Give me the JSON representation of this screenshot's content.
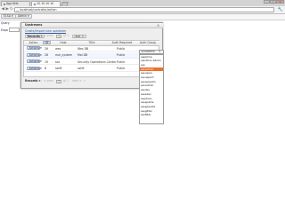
{
  "browser": {
    "tabs": [
      {
        "label": "App title"
      },
      {
        "label": "10.10.10.10"
      }
    ],
    "window_buttons": [
      "–",
      "□",
      "×"
    ],
    "address": "localhost/controller/action",
    "back_icon": "◀",
    "forward_icon": "▶",
    "reload_icon": "↻",
    "lock_icon": "⌂",
    "wrench_icon": "🔧"
  },
  "appmenu": {
    "items": [
      {
        "label": "ELSA ▾"
      },
      {
        "label": "Admin ▾"
      }
    ]
  },
  "background": {
    "label_1": "Query",
    "label_2": "Expo"
  },
  "modal": {
    "title": "Upstreams",
    "close_icon": "×",
    "link": "Create/Import new upstream"
  },
  "pager": {
    "records_label": "Records ▾",
    "first_icon": "«",
    "prev_icon": "‹",
    "prev_label": "< prev",
    "page_value": "1",
    "page_of": "of 1",
    "next_label": "next >",
    "last_icon": "»"
  },
  "grid": {
    "columns": [
      "Action",
      "ID",
      "Host",
      "Title",
      "Auth Required",
      "Auth Group"
    ],
    "rows": [
      {
        "action": "Actions ▾",
        "id": "26",
        "host": "wes",
        "title": "Wes DB",
        "auth": "Public"
      },
      {
        "action": "Actions ▾",
        "id": "28",
        "host": "mal_system",
        "title": "Mal DB",
        "auth": "Public"
      },
      {
        "action": "Actions ▾",
        "id": "19",
        "host": "soc",
        "title": "Security Operations Center",
        "auth": "Public"
      },
      {
        "action": "Actions ▾",
        "id": "8",
        "host": "sshft",
        "title": "sshft",
        "auth": "Public"
      }
    ]
  },
  "dropdown": {
    "value": "ssnadmin",
    "arrow_icon": "▾",
    "options": [
      "sapphire",
      "sandbox admin",
      "sss",
      "ssnadmin",
      "sssusers",
      "sssupport",
      "sssopsadm",
      "ssnadmin",
      "sssdev",
      "ssssdev",
      "ssadmin",
      "ssseparte",
      "ssseperate",
      "sssgitter",
      "sssfilter"
    ],
    "highlight_index": 3
  },
  "colors": {
    "accent": "#f06f2b",
    "link": "#2a55a0"
  }
}
